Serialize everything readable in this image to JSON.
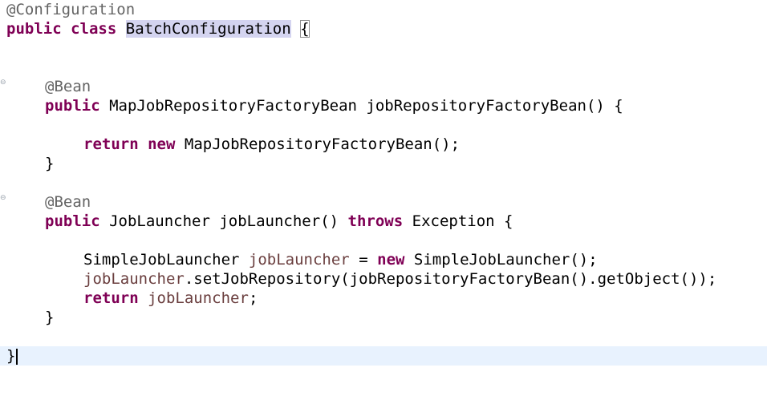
{
  "editor": {
    "lines": [
      {
        "annotation": "@Configuration"
      },
      {
        "kw1": "public",
        "kw2": "class",
        "class_name": "BatchConfiguration",
        "brace": "{"
      },
      {},
      {},
      {
        "annotation": "@Bean"
      },
      {
        "kw": "public",
        "type": "MapJobRepositoryFactoryBean",
        "method": "jobRepositoryFactoryBean() {"
      },
      {},
      {
        "kw1": "return",
        "kw2": "new",
        "rest": "MapJobRepositoryFactoryBean();"
      },
      {
        "text": "}"
      },
      {},
      {
        "annotation": "@Bean"
      },
      {
        "kw": "public",
        "signature": "JobLauncher jobLauncher()",
        "kw_throws": "throws",
        "rest": "Exception {"
      },
      {},
      {
        "type": "SimpleJobLauncher",
        "var": "jobLauncher",
        "op": "=",
        "kw_new": "new",
        "rest": "SimpleJobLauncher();"
      },
      {
        "var": "jobLauncher",
        "rest": ".setJobRepository(jobRepositoryFactoryBean().getObject());"
      },
      {
        "kw": "return",
        "var": "jobLauncher",
        "semi": ";"
      },
      {
        "text": "}"
      },
      {},
      {
        "text": "}"
      }
    ]
  }
}
